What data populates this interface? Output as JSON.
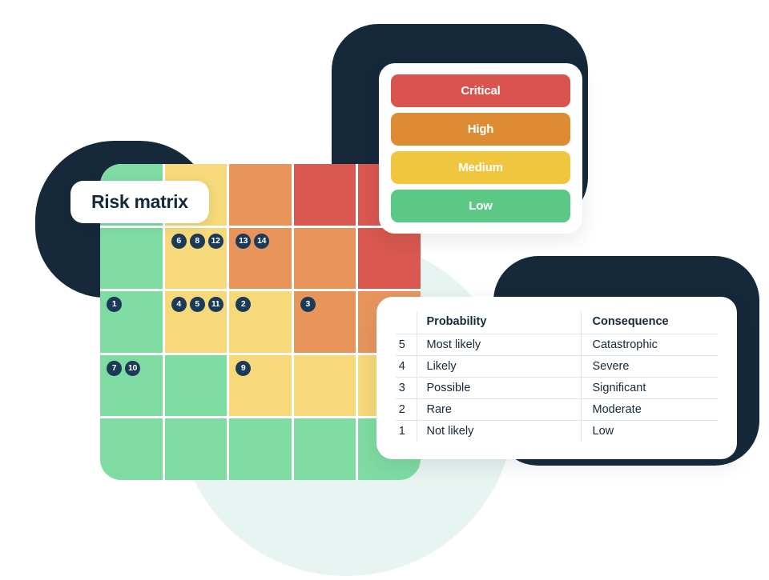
{
  "title_pill": {
    "label": "Risk matrix"
  },
  "colors": {
    "green": "#7edca2",
    "yellow": "#f5d97a",
    "orange": "#e8955c",
    "red": "#d9584f",
    "legend_critical": "#d9534f",
    "legend_high": "#dd8c33",
    "legend_medium": "#efc63e",
    "legend_low": "#5bc985",
    "badge": "#1b3a57",
    "navy": "#16293a",
    "mint": "#e8f4f1"
  },
  "legend": {
    "items": [
      {
        "label": "Critical",
        "color": "#d9534f"
      },
      {
        "label": "High",
        "color": "#dd8c33"
      },
      {
        "label": "Medium",
        "color": "#efc63e"
      },
      {
        "label": "Low",
        "color": "#5bc985"
      }
    ]
  },
  "table": {
    "headers": {
      "index": "",
      "probability": "Probability",
      "consequence": "Consequence"
    },
    "rows": [
      {
        "index": "5",
        "probability": "Most likely",
        "consequence": "Catastrophic"
      },
      {
        "index": "4",
        "probability": "Likely",
        "consequence": "Severe"
      },
      {
        "index": "3",
        "probability": "Possible",
        "consequence": "Significant"
      },
      {
        "index": "2",
        "probability": "Rare",
        "consequence": "Moderate"
      },
      {
        "index": "1",
        "probability": "Not likely",
        "consequence": "Low"
      }
    ]
  },
  "chart_data": {
    "type": "heatmap",
    "title": "Risk matrix",
    "xlabel": "Consequence",
    "ylabel": "Probability",
    "x_categories": [
      "Low",
      "Moderate",
      "Significant",
      "Severe",
      "Catastrophic"
    ],
    "y_categories": [
      "Most likely",
      "Likely",
      "Possible",
      "Rare",
      "Not likely"
    ],
    "risk_levels": [
      "Low",
      "Medium",
      "High",
      "Critical"
    ],
    "cells": [
      {
        "row": 0,
        "col": 0,
        "level": "Low",
        "color": "#7edca2",
        "markers": []
      },
      {
        "row": 0,
        "col": 1,
        "level": "Medium",
        "color": "#f5d97a",
        "markers": []
      },
      {
        "row": 0,
        "col": 2,
        "level": "High",
        "color": "#e8955c",
        "markers": []
      },
      {
        "row": 0,
        "col": 3,
        "level": "Critical",
        "color": "#d9584f",
        "markers": []
      },
      {
        "row": 0,
        "col": 4,
        "level": "Critical",
        "color": "#d9584f",
        "markers": []
      },
      {
        "row": 1,
        "col": 0,
        "level": "Low",
        "color": "#7edca2",
        "markers": []
      },
      {
        "row": 1,
        "col": 1,
        "level": "Medium",
        "color": "#f5d97a",
        "markers": [
          "6",
          "8",
          "12"
        ]
      },
      {
        "row": 1,
        "col": 2,
        "level": "High",
        "color": "#e8955c",
        "markers": [
          "13",
          "14"
        ]
      },
      {
        "row": 1,
        "col": 3,
        "level": "High",
        "color": "#e8955c",
        "markers": []
      },
      {
        "row": 1,
        "col": 4,
        "level": "Critical",
        "color": "#d9584f",
        "markers": []
      },
      {
        "row": 2,
        "col": 0,
        "level": "Low",
        "color": "#7edca2",
        "markers": [
          "1"
        ]
      },
      {
        "row": 2,
        "col": 1,
        "level": "Medium",
        "color": "#f5d97a",
        "markers": [
          "4",
          "5",
          "11"
        ]
      },
      {
        "row": 2,
        "col": 2,
        "level": "Medium",
        "color": "#f5d97a",
        "markers": [
          "2"
        ]
      },
      {
        "row": 2,
        "col": 3,
        "level": "High",
        "color": "#e8955c",
        "markers": [
          "3"
        ]
      },
      {
        "row": 2,
        "col": 4,
        "level": "High",
        "color": "#e8955c",
        "markers": []
      },
      {
        "row": 3,
        "col": 0,
        "level": "Low",
        "color": "#7edca2",
        "markers": [
          "7",
          "10"
        ]
      },
      {
        "row": 3,
        "col": 1,
        "level": "Low",
        "color": "#7edca2",
        "markers": []
      },
      {
        "row": 3,
        "col": 2,
        "level": "Medium",
        "color": "#f5d97a",
        "markers": [
          "9"
        ]
      },
      {
        "row": 3,
        "col": 3,
        "level": "Medium",
        "color": "#f5d97a",
        "markers": []
      },
      {
        "row": 3,
        "col": 4,
        "level": "Medium",
        "color": "#f5d97a",
        "markers": []
      },
      {
        "row": 4,
        "col": 0,
        "level": "Low",
        "color": "#7edca2",
        "markers": []
      },
      {
        "row": 4,
        "col": 1,
        "level": "Low",
        "color": "#7edca2",
        "markers": []
      },
      {
        "row": 4,
        "col": 2,
        "level": "Low",
        "color": "#7edca2",
        "markers": []
      },
      {
        "row": 4,
        "col": 3,
        "level": "Low",
        "color": "#7edca2",
        "markers": []
      },
      {
        "row": 4,
        "col": 4,
        "level": "Low",
        "color": "#7edca2",
        "markers": []
      }
    ]
  }
}
